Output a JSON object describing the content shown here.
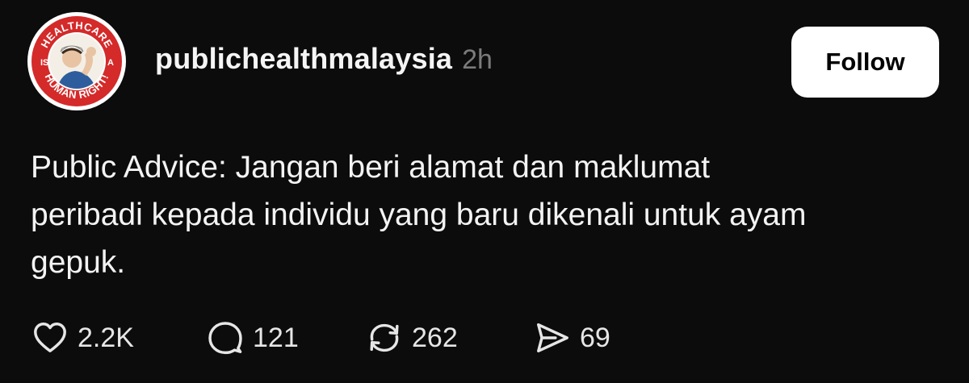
{
  "post": {
    "avatar": {
      "ring_text_top": "HEALTHCARE",
      "ring_text_left": "IS",
      "ring_text_right": "A",
      "ring_text_bottom": "HUMAN RIGHT!",
      "ring_color": "#d42a2a"
    },
    "username": "publichealthmalaysia",
    "timestamp": "2h",
    "follow_label": "Follow",
    "body_lines": [
      "Public Advice: Jangan beri alamat dan maklumat",
      "peribadi kepada individu yang baru dikenali untuk ayam",
      "gepuk."
    ],
    "actions": {
      "likes": "2.2K",
      "replies": "121",
      "reposts": "262",
      "shares": "69"
    },
    "icons": {
      "like": "heart-icon",
      "reply": "speech-bubble-icon",
      "repost": "repost-icon",
      "share": "send-icon"
    }
  },
  "colors": {
    "background": "#0c0c0c",
    "text": "#f3f3f3",
    "muted": "#7b7b7b",
    "button_bg": "#ffffff",
    "button_text": "#000000"
  }
}
